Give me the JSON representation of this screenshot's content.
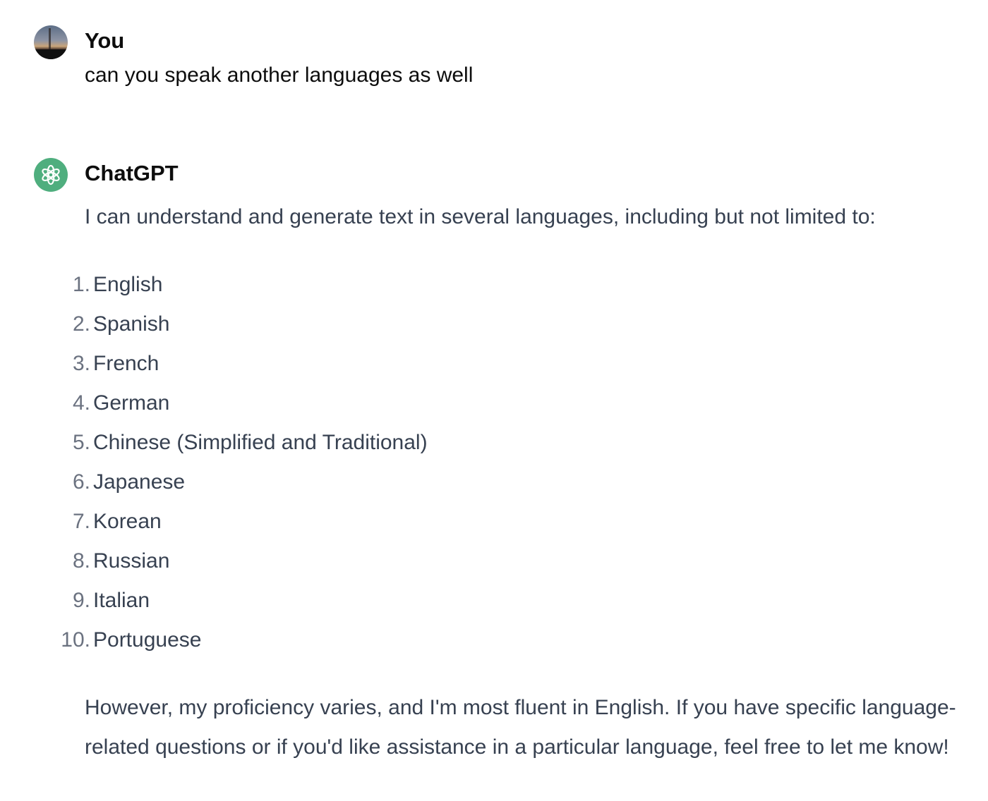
{
  "conversation": {
    "user_message": {
      "author": "You",
      "avatar_icon": "user-avatar-photo",
      "text": "can you speak another languages as well"
    },
    "assistant_message": {
      "author": "ChatGPT",
      "avatar_icon": "openai-logo-icon",
      "avatar_color": "#4fae7e",
      "intro": "I can understand and generate text in several languages, including but not limited to:",
      "languages": [
        {
          "num": "1.",
          "name": "English"
        },
        {
          "num": "2.",
          "name": "Spanish"
        },
        {
          "num": "3.",
          "name": "French"
        },
        {
          "num": "4.",
          "name": "German"
        },
        {
          "num": "5.",
          "name": "Chinese (Simplified and Traditional)"
        },
        {
          "num": "6.",
          "name": "Japanese"
        },
        {
          "num": "7.",
          "name": "Korean"
        },
        {
          "num": "8.",
          "name": "Russian"
        },
        {
          "num": "9.",
          "name": "Italian"
        },
        {
          "num": "10.",
          "name": "Portuguese"
        }
      ],
      "outro": "However, my proficiency varies, and I'm most fluent in English. If you have specific language-related questions or if you'd like assistance in a particular language, feel free to let me know!"
    }
  }
}
